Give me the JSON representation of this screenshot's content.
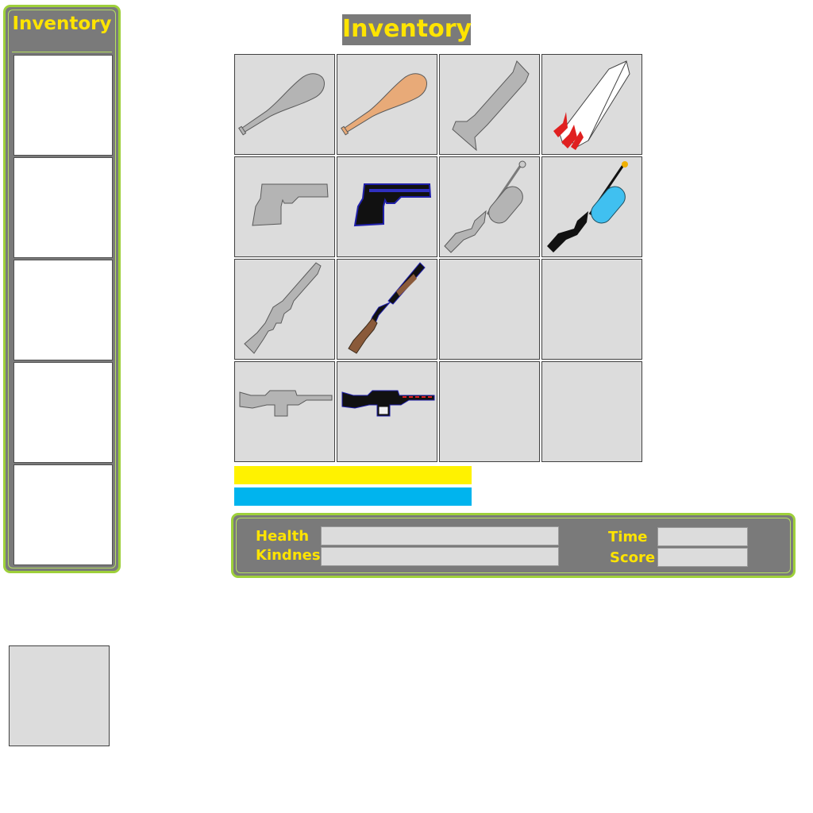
{
  "side_panel": {
    "title": "Inventory",
    "slots": [
      {
        "item": ""
      },
      {
        "item": ""
      },
      {
        "item": ""
      },
      {
        "item": ""
      },
      {
        "item": ""
      }
    ]
  },
  "main": {
    "title": "Inventory",
    "grid": [
      {
        "item": "baseball-bat-gray-icon"
      },
      {
        "item": "baseball-bat-wood-icon"
      },
      {
        "item": "rocket-gray-icon"
      },
      {
        "item": "rocket-red-white-icon"
      },
      {
        "item": "pistol-gray-icon"
      },
      {
        "item": "pistol-black-blue-icon"
      },
      {
        "item": "water-gun-gray-icon"
      },
      {
        "item": "water-gun-blue-icon"
      },
      {
        "item": "shotgun-gray-icon"
      },
      {
        "item": "shotgun-wood-icon"
      },
      {
        "item": ""
      },
      {
        "item": ""
      },
      {
        "item": "assault-rifle-gray-icon"
      },
      {
        "item": "assault-rifle-black-icon"
      },
      {
        "item": ""
      },
      {
        "item": ""
      }
    ]
  },
  "bars": {
    "kindness": {
      "fill": 1.0,
      "color": "#fff200"
    },
    "health": {
      "fill": 1.0,
      "color": "#00b4ee"
    }
  },
  "stats": {
    "health_label": "Health",
    "kindness_label": "Kindness",
    "time_label": "Time",
    "score_label": "Score",
    "health_value": "",
    "kindness_value": "",
    "time_value": "",
    "score_value": ""
  },
  "selected_slot": {
    "item": ""
  },
  "colors": {
    "frame": "#7a7a7a",
    "accent_green": "#9ed03a",
    "text_yellow": "#ffe400",
    "slot_gray": "#dcdcdc"
  }
}
